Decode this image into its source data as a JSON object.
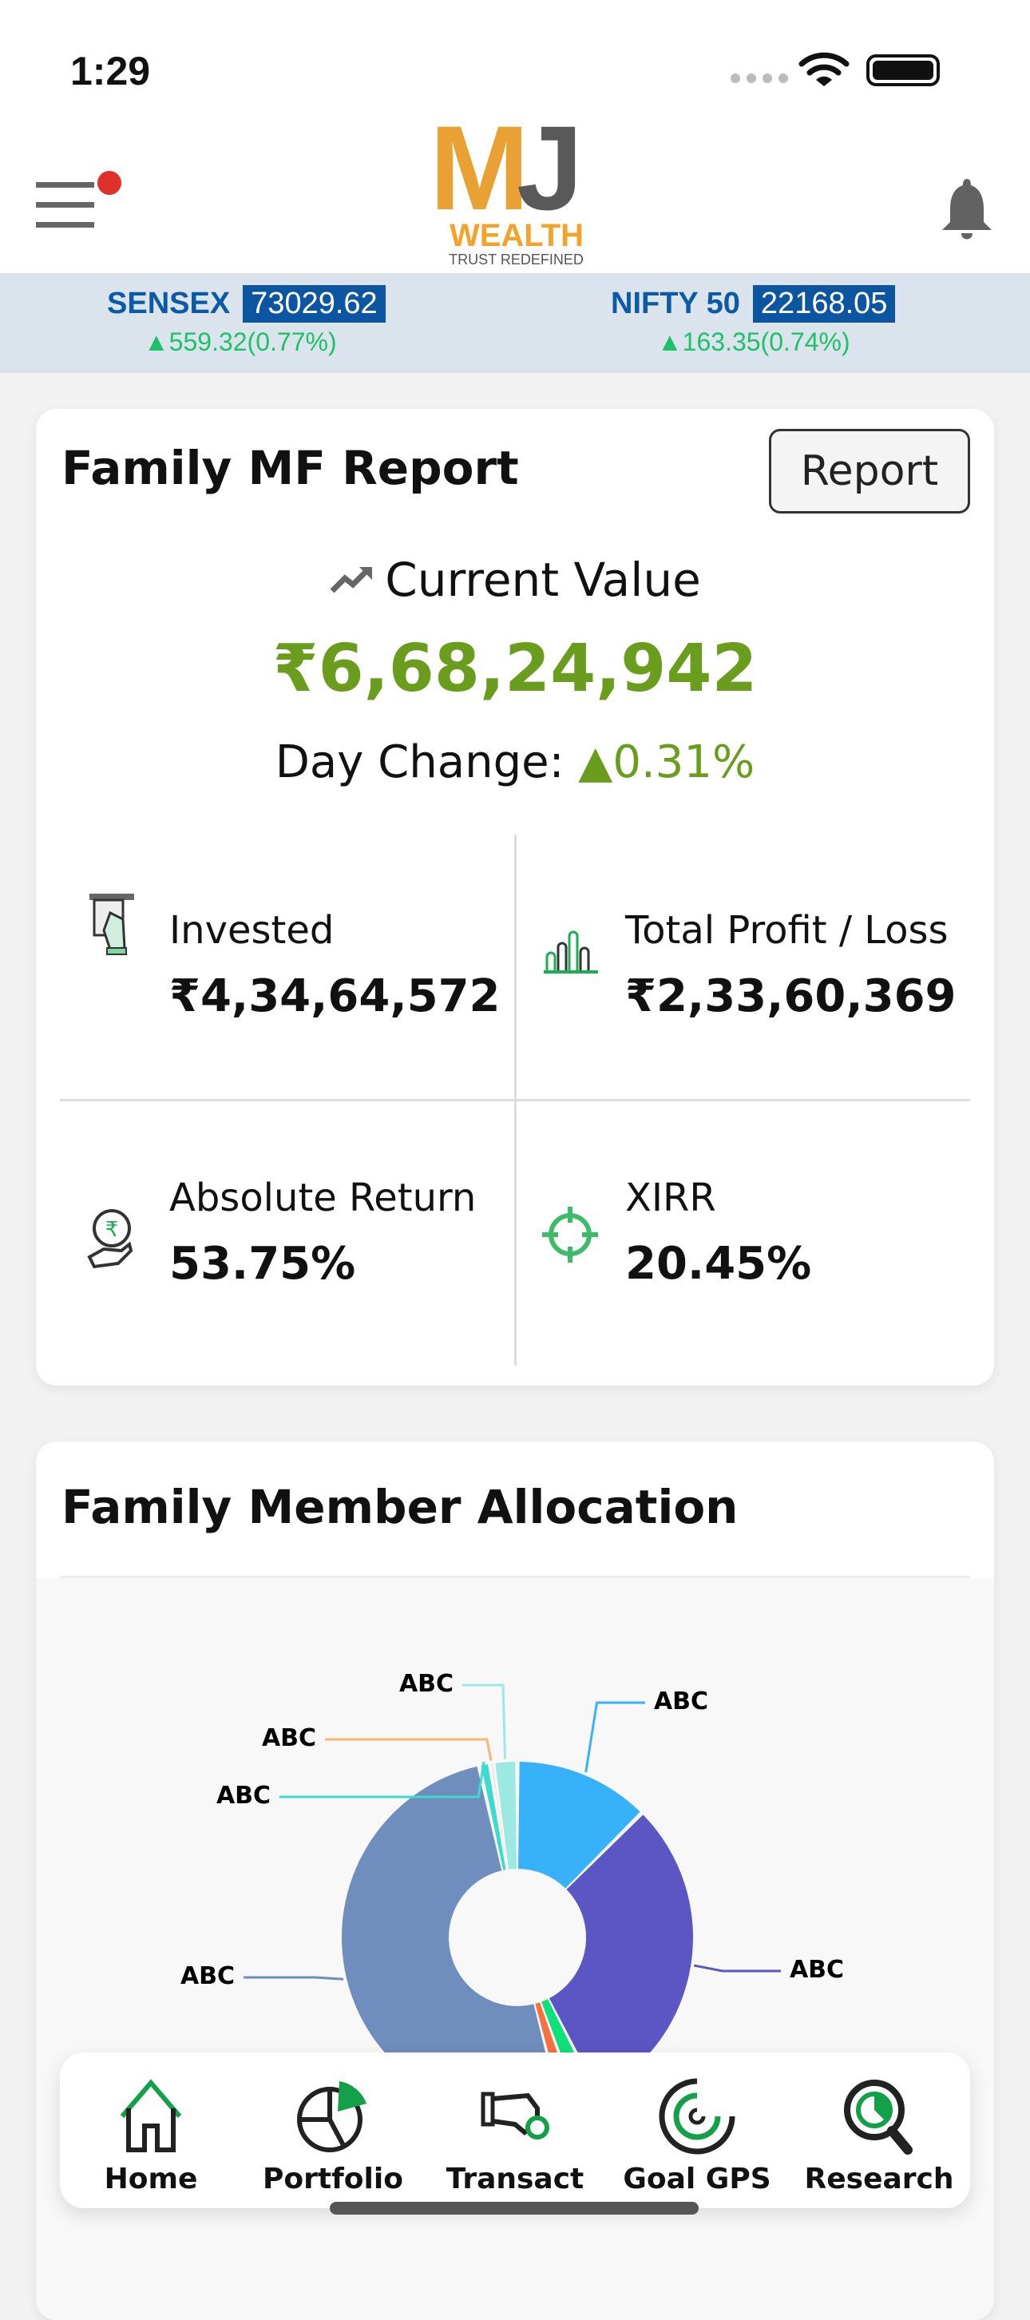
{
  "status_bar": {
    "time": "1:29"
  },
  "header": {
    "logo": {
      "mark": "MJ",
      "name": "WEALTH",
      "tagline": "TRUST REDEFINED"
    },
    "menu_icon": "hamburger-icon",
    "notification_icon": "bell-icon",
    "menu_badge_color": "#e0302a"
  },
  "ticker": [
    {
      "name": "SENSEX",
      "value": "73029.62",
      "change": "▲559.32(0.77%)"
    },
    {
      "name": "NIFTY 50",
      "value": "22168.05",
      "change": "▲163.35(0.74%)"
    }
  ],
  "mf_report": {
    "title": "Family MF Report",
    "report_button": "Report",
    "current_value_label": "Current Value",
    "current_value": "₹6,68,24,942",
    "day_change_label": "Day Change:",
    "day_change": "▲0.31%",
    "stats": [
      {
        "label": "Invested",
        "value": "₹4,34,64,572",
        "icon": "invest-cash-icon"
      },
      {
        "label": "Total Profit / Loss",
        "value": "₹2,33,60,369",
        "icon": "bar-chart-icon"
      },
      {
        "label": "Absolute Return",
        "value": "53.75%",
        "icon": "rupee-hand-icon"
      },
      {
        "label": "XIRR",
        "value": "20.45%",
        "icon": "target-icon"
      }
    ],
    "accent_color": "#6a9d1e"
  },
  "allocation": {
    "title": "Family Member Allocation"
  },
  "chart_data": {
    "type": "pie",
    "donut": true,
    "categories": [
      "ABC",
      "ABC",
      "",
      "",
      "ABC",
      "ABC",
      "ABC",
      "ABC"
    ],
    "values": [
      12.5,
      30,
      2,
      1.5,
      50.5,
      1,
      0.3,
      2.2
    ],
    "colors": [
      "#38b1fb",
      "#5b56c4",
      "#0ee07a",
      "#f77040",
      "#6f8dbd",
      "#3ddbce",
      "#f8b574",
      "#9ce9e3"
    ]
  },
  "bottom_nav": [
    {
      "label": "Home",
      "icon": "home-icon"
    },
    {
      "label": "Portfolio",
      "icon": "pie-chart-icon"
    },
    {
      "label": "Transact",
      "icon": "hand-coin-icon"
    },
    {
      "label": "Goal GPS",
      "icon": "goal-target-icon"
    },
    {
      "label": "Research",
      "icon": "magnifier-chart-icon"
    }
  ]
}
